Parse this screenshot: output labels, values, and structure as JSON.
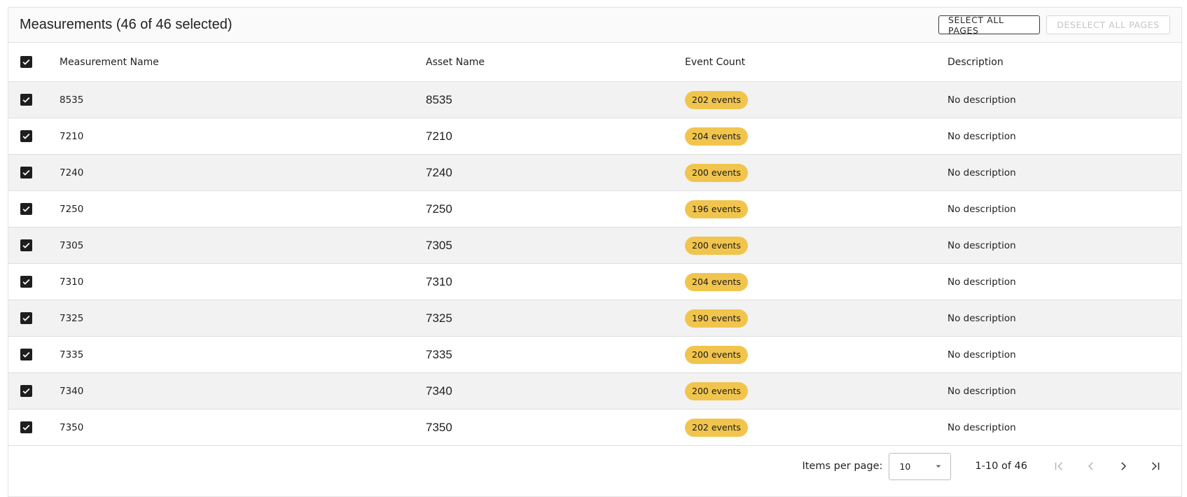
{
  "header": {
    "title": "Measurements (46 of 46 selected)",
    "select_all_label": "SELECT ALL PAGES",
    "deselect_all_label": "DESELECT ALL PAGES"
  },
  "columns": {
    "name": "Measurement Name",
    "asset": "Asset Name",
    "event": "Event Count",
    "description": "Description"
  },
  "rows": [
    {
      "name": "8535",
      "asset": "8535",
      "events": "202 events",
      "description": "No description",
      "checked": true
    },
    {
      "name": "7210",
      "asset": "7210",
      "events": "204 events",
      "description": "No description",
      "checked": true
    },
    {
      "name": "7240",
      "asset": "7240",
      "events": "200 events",
      "description": "No description",
      "checked": true
    },
    {
      "name": "7250",
      "asset": "7250",
      "events": "196 events",
      "description": "No description",
      "checked": true
    },
    {
      "name": "7305",
      "asset": "7305",
      "events": "200 events",
      "description": "No description",
      "checked": true
    },
    {
      "name": "7310",
      "asset": "7310",
      "events": "204 events",
      "description": "No description",
      "checked": true
    },
    {
      "name": "7325",
      "asset": "7325",
      "events": "190 events",
      "description": "No description",
      "checked": true
    },
    {
      "name": "7335",
      "asset": "7335",
      "events": "200 events",
      "description": "No description",
      "checked": true
    },
    {
      "name": "7340",
      "asset": "7340",
      "events": "200 events",
      "description": "No description",
      "checked": true
    },
    {
      "name": "7350",
      "asset": "7350",
      "events": "202 events",
      "description": "No description",
      "checked": true
    }
  ],
  "footer": {
    "items_per_page_label": "Items per page:",
    "items_per_page_value": "10",
    "range_label": "1-10 of 46"
  },
  "colors": {
    "badge": "#f1c54d",
    "checkbox": "#1e1e1e",
    "row_alt": "#f2f2f2"
  },
  "icons": {
    "checkbox": "check-icon",
    "select_caret": "caret-down-icon",
    "first_page": "first-page-icon",
    "prev_page": "chevron-left-icon",
    "next_page": "chevron-right-icon",
    "last_page": "last-page-icon"
  }
}
